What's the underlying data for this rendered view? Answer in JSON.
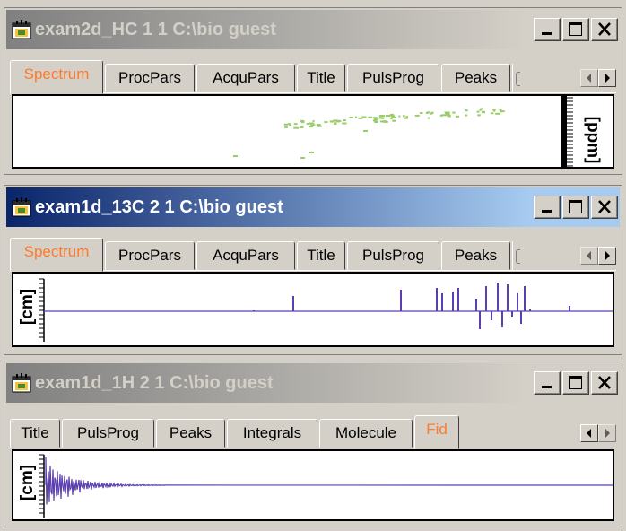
{
  "windows": [
    {
      "id": "w1",
      "title": "exam2d_HC  1  1  C:\\bio  guest",
      "active": false,
      "tabs": [
        "Spectrum",
        "ProcPars",
        "AcquPars",
        "Title",
        "PulsProg",
        "Peaks"
      ],
      "selected_tab": "Spectrum",
      "axis_unit": "[ppm]"
    },
    {
      "id": "w2",
      "title": "exam1d_13C  2  1  C:\\bio  guest",
      "active": true,
      "tabs": [
        "Spectrum",
        "ProcPars",
        "AcquPars",
        "Title",
        "PulsProg",
        "Peaks"
      ],
      "selected_tab": "Spectrum",
      "axis_unit": "[cm]"
    },
    {
      "id": "w3",
      "title": "exam1d_1H  2  1  C:\\bio  guest",
      "active": false,
      "tabs": [
        "Title",
        "PulsProg",
        "Peaks",
        "Integrals",
        "Molecule",
        "Fid"
      ],
      "selected_tab": "Fid",
      "axis_unit": "[cm]"
    }
  ],
  "colors": {
    "window_bg": "#d4d0c8",
    "active_title": "#0a246a",
    "inactive_title": "#808080",
    "selected_tab_text": "#ff7a2a",
    "spectrum_line": "#5b3fb0",
    "contour_green": "#9acd6a"
  },
  "icons": {
    "app_icon": "app-window-icon",
    "minimize": "minimize-icon",
    "maximize": "maximize-icon",
    "close": "close-icon",
    "scroll_left": "scroll-left-icon",
    "scroll_right": "scroll-right-icon"
  }
}
